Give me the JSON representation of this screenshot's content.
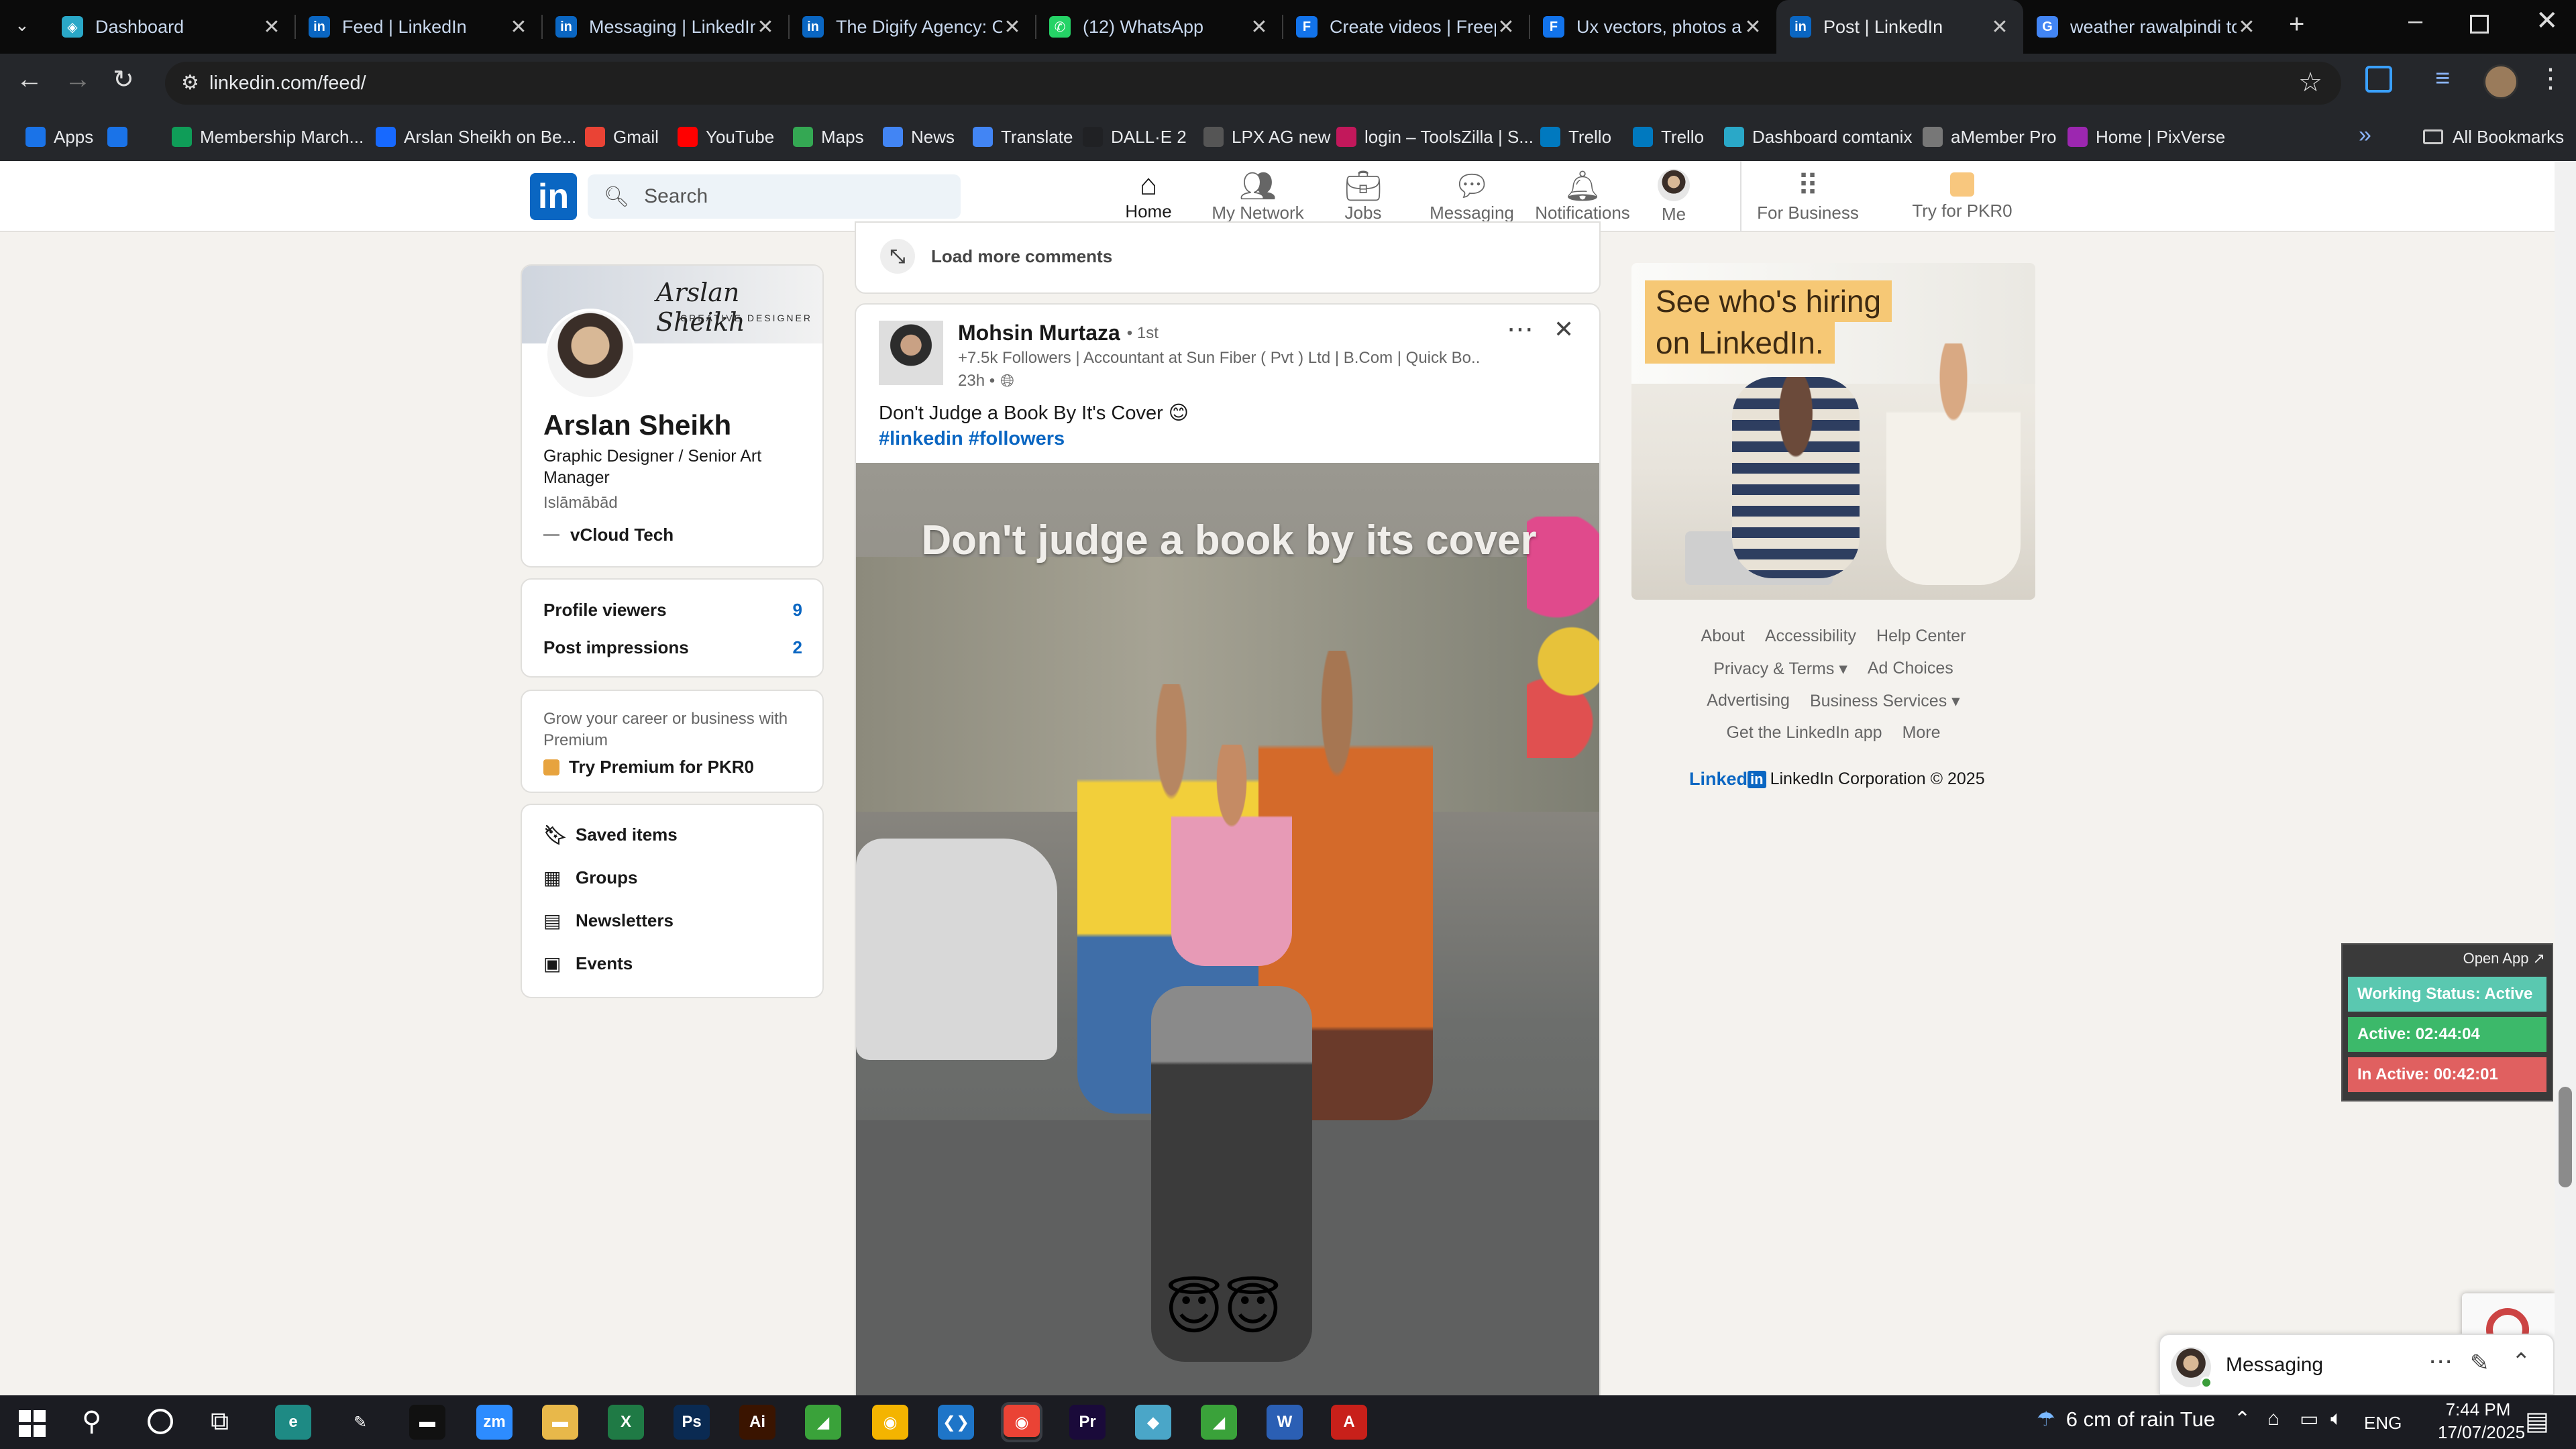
{
  "browser": {
    "tabs": [
      {
        "title": "Dashboard",
        "icon": "vcloud-icon",
        "color": "#2aa8c8",
        "active": false
      },
      {
        "title": "Feed | LinkedIn",
        "icon": "linkedin-icon",
        "color": "#0a66c2",
        "active": false
      },
      {
        "title": "Messaging | LinkedIn",
        "icon": "linkedin-icon",
        "color": "#0a66c2",
        "active": false
      },
      {
        "title": "The Digify Agency: O",
        "icon": "linkedin-icon",
        "color": "#0a66c2",
        "active": false
      },
      {
        "title": "(12) WhatsApp",
        "icon": "whatsapp-icon",
        "color": "#25d366",
        "active": false
      },
      {
        "title": "Create videos | Freep",
        "icon": "freepik-icon",
        "color": "#1273eb",
        "active": false
      },
      {
        "title": "Ux vectors, photos an",
        "icon": "freepik-icon",
        "color": "#1273eb",
        "active": false
      },
      {
        "title": "Post | LinkedIn",
        "icon": "linkedin-icon",
        "color": "#0a66c2",
        "active": true
      },
      {
        "title": "weather rawalpindi to",
        "icon": "google-icon",
        "color": "#4285f4",
        "active": false
      }
    ],
    "new_tab": "+",
    "url": "linkedin.com/feed/",
    "bookmarks": [
      {
        "label": "Apps",
        "color": "#1a73e8"
      },
      {
        "label": "",
        "color": "#1a73e8"
      },
      {
        "label": "Membership March...",
        "color": "#0f9d58"
      },
      {
        "label": "Arslan Sheikh on Be...",
        "color": "#1769ff"
      },
      {
        "label": "Gmail",
        "color": "#ea4335"
      },
      {
        "label": "YouTube",
        "color": "#ff0000"
      },
      {
        "label": "Maps",
        "color": "#34a853"
      },
      {
        "label": "News",
        "color": "#4285f4"
      },
      {
        "label": "Translate",
        "color": "#4285f4"
      },
      {
        "label": "DALL·E 2",
        "color": "#202124"
      },
      {
        "label": "LPX AG new",
        "color": "#555"
      },
      {
        "label": "login – ToolsZilla | S...",
        "color": "#c2185b"
      },
      {
        "label": "Trello",
        "color": "#0079bf"
      },
      {
        "label": "Trello",
        "color": "#0079bf"
      },
      {
        "label": "Dashboard comtanix",
        "color": "#2aa8c8"
      },
      {
        "label": "aMember Pro",
        "color": "#777"
      },
      {
        "label": "Home | PixVerse",
        "color": "#9c27b0"
      }
    ],
    "all_bookmarks": "All Bookmarks"
  },
  "linkedin": {
    "logo": "in",
    "search_placeholder": "Search",
    "nav": [
      {
        "label": "Home",
        "icon": "home-icon",
        "active": true
      },
      {
        "label": "My Network",
        "icon": "network-icon",
        "active": false
      },
      {
        "label": "Jobs",
        "icon": "briefcase-icon",
        "active": false
      },
      {
        "label": "Messaging",
        "icon": "message-icon",
        "active": false
      },
      {
        "label": "Notifications",
        "icon": "bell-icon",
        "active": false
      },
      {
        "label": "Me",
        "icon": "avatar-icon",
        "active": false
      }
    ],
    "for_business": "For Business",
    "try_premium": "Try for PKR0",
    "profile": {
      "banner_name": "Arslan Sheikh",
      "banner_sub": "CREATIVE DESIGNER",
      "name": "Arslan Sheikh",
      "headline": "Graphic Designer / Senior Art Manager",
      "location": "Islāmābād",
      "company": "vCloud Tech"
    },
    "stats": [
      {
        "label": "Profile viewers",
        "value": "9"
      },
      {
        "label": "Post impressions",
        "value": "2"
      }
    ],
    "premium_text": "Grow your career or business with Premium",
    "premium_cta": "Try Premium for PKR0",
    "shortcuts": [
      {
        "label": "Saved items",
        "icon": "bookmark-icon"
      },
      {
        "label": "Groups",
        "icon": "groups-icon"
      },
      {
        "label": "Newsletters",
        "icon": "newsletter-icon"
      },
      {
        "label": "Events",
        "icon": "calendar-icon"
      }
    ],
    "load_more": "Load more comments",
    "post": {
      "author": "Mohsin Murtaza",
      "degree": "• 1st",
      "followers": "+7.5k Followers | Accountant at Sun Fiber ( Pvt ) Ltd | B.Com | Quick Bo...",
      "time": "23h •",
      "text": "Don't Judge a Book By It's Cover 😊",
      "hashtags": "#linkedin #followers",
      "media_caption": "Don't judge a book by its cover",
      "emoji": "😇😇"
    },
    "ad": {
      "line1": "See who's hiring",
      "line2": "on LinkedIn."
    },
    "footer_links": [
      [
        "About",
        "Accessibility",
        "Help Center"
      ],
      [
        "Privacy & Terms ▾",
        "Ad Choices"
      ],
      [
        "Advertising",
        "Business Services ▾"
      ],
      [
        "Get the LinkedIn app",
        "More"
      ]
    ],
    "footer_brand": "Linked",
    "copyright": "LinkedIn Corporation © 2025",
    "messaging": "Messaging"
  },
  "widget": {
    "open_app": "Open App ↗",
    "working_status": "Working Status: Active",
    "active": "Active: 02:44:04",
    "inactive": "In Active: 00:42:01",
    "colors": {
      "working": "#5ac8b0",
      "active": "#3cb96a",
      "inactive": "#e06060"
    }
  },
  "taskbar": {
    "weather": "6 cm of rain Tue",
    "language": "ENG",
    "time": "7:44 PM",
    "date": "17/07/2025"
  }
}
